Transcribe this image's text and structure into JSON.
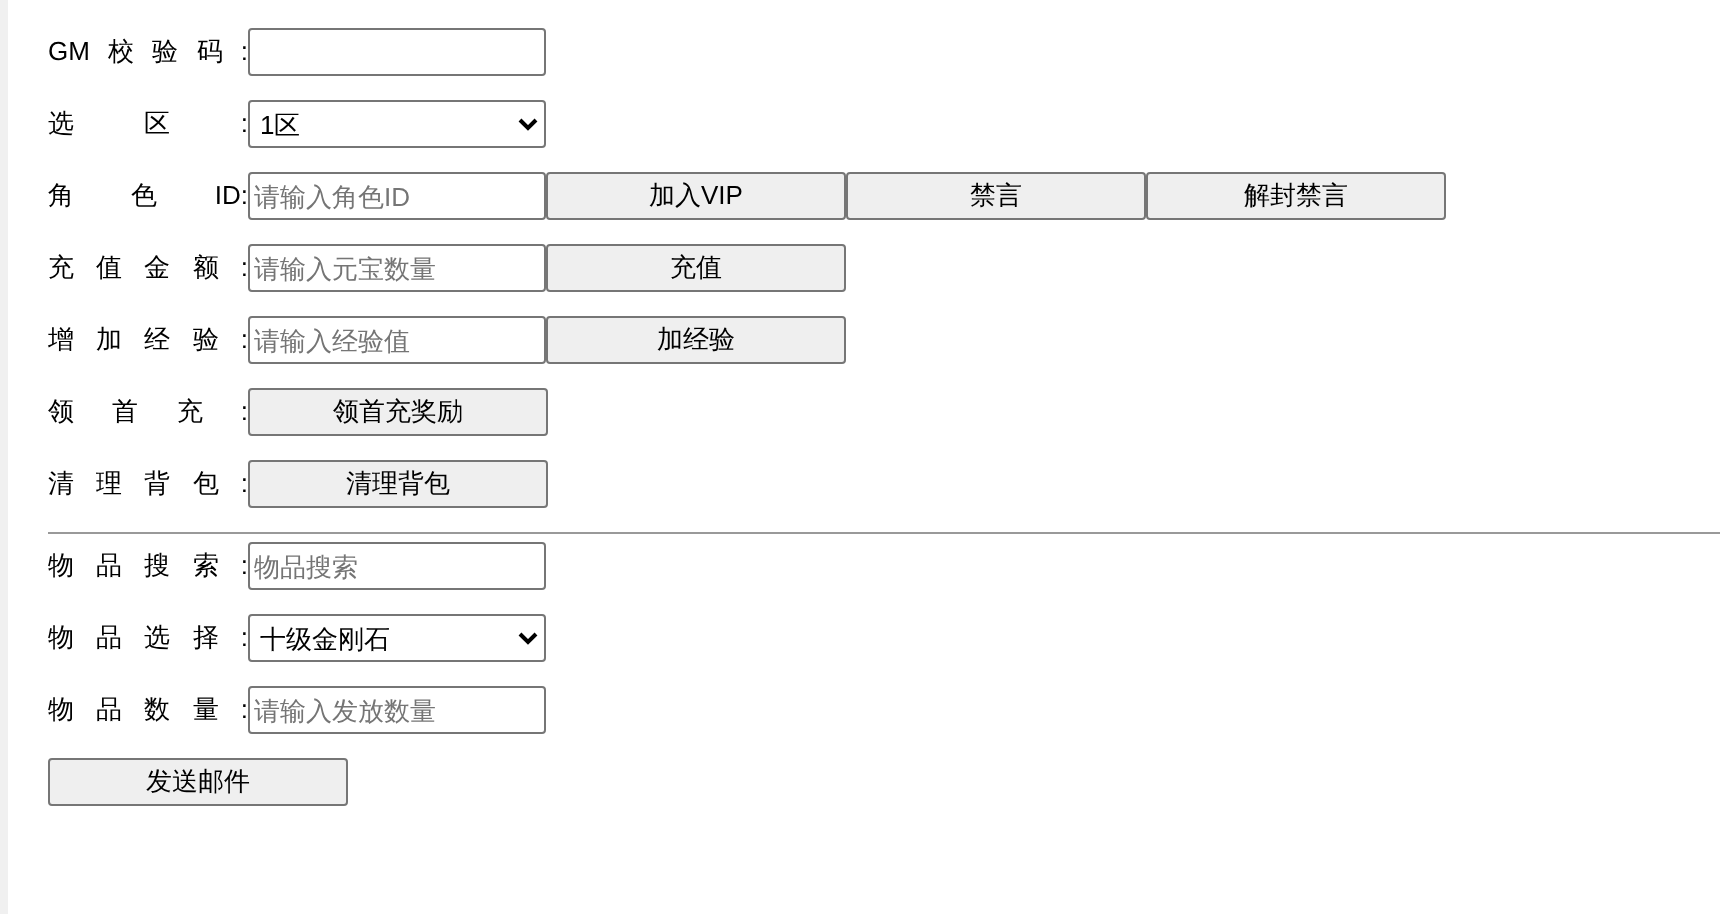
{
  "sections": [
    {
      "rows": [
        {
          "label": "GM校验码:",
          "control": {
            "kind": "input"
          },
          "buttons": []
        },
        {
          "label": "选区:",
          "control": {
            "kind": "select",
            "value": "1区"
          },
          "buttons": []
        },
        {
          "label": "角色ID:",
          "control": {
            "kind": "input",
            "placeholder": "请输入角色ID"
          },
          "buttons": [
            "加入VIP",
            "禁言",
            "解封禁言"
          ]
        },
        {
          "label": "充值金额:",
          "control": {
            "kind": "input",
            "placeholder": "请输入元宝数量"
          },
          "buttons": [
            "充值"
          ]
        },
        {
          "label": "增加经验:",
          "control": {
            "kind": "input",
            "placeholder": "请输入经验值"
          },
          "buttons": [
            "加经验"
          ]
        },
        {
          "label": "领首充:",
          "control": {
            "kind": "button",
            "label": "领首充奖励"
          },
          "buttons": []
        },
        {
          "label": "清理背包:",
          "control": {
            "kind": "button",
            "label": "清理背包"
          },
          "buttons": []
        }
      ]
    },
    {
      "rows": [
        {
          "label": "物品搜索:",
          "control": {
            "kind": "input",
            "placeholder": "物品搜索"
          },
          "buttons": []
        },
        {
          "label": "物品选择:",
          "control": {
            "kind": "select",
            "value": "十级金刚石"
          },
          "buttons": []
        },
        {
          "label": "物品数量:",
          "control": {
            "kind": "input",
            "placeholder": "请输入发放数量"
          },
          "buttons": []
        }
      ]
    }
  ],
  "submit": "发送邮件"
}
